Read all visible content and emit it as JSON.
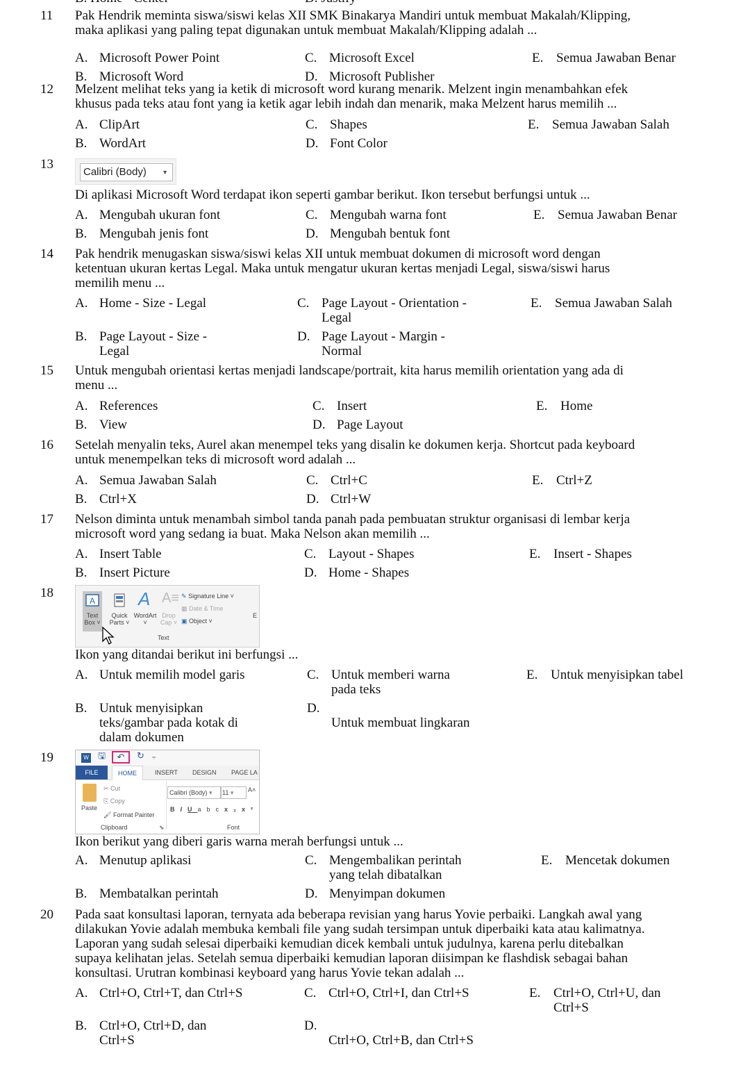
{
  "document": {
    "cut_line": {
      "left": "B.  Home - Center",
      "right": "D.  Justify"
    },
    "questions": [
      {
        "num": "11",
        "text": [
          "Pak Hendrik meminta siswa/siswi kelas XII SMK Binakarya Mandiri untuk membuat Makalah/Klipping,",
          "maka aplikasi yang paling tepat digunakan untuk membuat Makalah/Klipping adalah ..."
        ],
        "options": {
          "A": [
            "Microsoft Power Point"
          ],
          "B": [
            "Microsoft Word"
          ],
          "C": [
            "Microsoft Excel"
          ],
          "D": [
            "Microsoft Publisher"
          ],
          "E": [
            "Semua Jawaban Benar"
          ]
        }
      },
      {
        "num": "12",
        "text": [
          "Melzent melihat teks yang ia ketik di microsoft word kurang menarik. Melzent ingin menambahkan efek",
          "khusus pada teks atau font yang ia ketik agar lebih indah dan menarik, maka Melzent harus memilih ..."
        ],
        "options": {
          "A": [
            "ClipArt"
          ],
          "B": [
            "WordArt"
          ],
          "C": [
            "Shapes"
          ],
          "D": [
            "Font Color"
          ],
          "E": [
            "Semua Jawaban Salah"
          ]
        }
      },
      {
        "num": "13",
        "image": {
          "font_box_value": "Calibri (Body)",
          "dropdown_icon": "caret-down"
        },
        "text": [
          "Di aplikasi Microsoft Word terdapat ikon seperti gambar berikut. Ikon tersebut berfungsi untuk ..."
        ],
        "options": {
          "A": [
            "Mengubah ukuran font"
          ],
          "B": [
            "Mengubah jenis font"
          ],
          "C": [
            "Mengubah warna font"
          ],
          "D": [
            "Mengubah bentuk font"
          ],
          "E": [
            "Semua Jawaban Benar"
          ]
        }
      },
      {
        "num": "14",
        "text": [
          "Pak hendrik menugaskan siswa/siswi kelas XII untuk membuat dokumen di microsoft word dengan",
          "ketentuan ukuran kertas Legal. Maka untuk mengatur ukuran kertas menjadi Legal, siswa/siswi harus",
          "memilih menu ..."
        ],
        "options": {
          "A": [
            "Home - Size - Legal"
          ],
          "B": [
            "Page Layout - Size -",
            "Legal"
          ],
          "C": [
            "Page Layout - Orientation -",
            "Legal"
          ],
          "D": [
            "Page Layout - Margin -",
            "Normal"
          ],
          "E": [
            "Semua Jawaban Salah"
          ]
        }
      },
      {
        "num": "15",
        "text": [
          "Untuk mengubah orientasi kertas menjadi landscape/portrait, kita harus memilih orientation yang ada di",
          "menu ..."
        ],
        "options": {
          "A": [
            "References"
          ],
          "B": [
            "View"
          ],
          "C": [
            "Insert"
          ],
          "D": [
            "Page Layout"
          ],
          "E": [
            "Home"
          ]
        }
      },
      {
        "num": "16",
        "text": [
          "Setelah menyalin teks, Aurel akan menempel teks yang disalin ke dokumen kerja. Shortcut pada keyboard",
          "untuk menempelkan teks di microsoft word adalah ..."
        ],
        "options": {
          "A": [
            "Semua Jawaban Salah"
          ],
          "B": [
            "Ctrl+X"
          ],
          "C": [
            "Ctrl+C"
          ],
          "D": [
            "Ctrl+W"
          ],
          "E": [
            "Ctrl+Z"
          ]
        }
      },
      {
        "num": "17",
        "text": [
          "Nelson diminta untuk menambah simbol tanda panah pada pembuatan struktur organisasi di lembar kerja",
          "microsoft word yang sedang ia buat. Maka Nelson akan memilih ..."
        ],
        "options": {
          "A": [
            "Insert Table"
          ],
          "B": [
            "Insert Picture"
          ],
          "C": [
            "Layout - Shapes"
          ],
          "D": [
            "Home - Shapes"
          ],
          "E": [
            "Insert - Shapes"
          ]
        }
      },
      {
        "num": "18",
        "image": {
          "items": {
            "text_box": [
              "Text",
              "Box ˅"
            ],
            "quick_parts": [
              "Quick",
              "Parts ˅"
            ],
            "wordart": [
              "WordArt",
              "˅"
            ],
            "drop_cap": [
              "Drop",
              "Cap ˅"
            ],
            "signature_line": "Signature Line  ˅",
            "date_time": "Date & Time",
            "object": "Object  ˅",
            "group_label": "Text",
            "cut_label": "E"
          }
        },
        "text": [
          "Ikon yang ditandai berikut ini berfungsi ..."
        ],
        "options": {
          "A": [
            "Untuk memilih model garis"
          ],
          "B": [
            "Untuk menyisipkan",
            "teks/gambar pada kotak di",
            "dalam dokumen"
          ],
          "C": [
            "Untuk memberi warna",
            "pada teks"
          ],
          "D": [
            "",
            "Untuk membuat lingkaran"
          ],
          "E": [
            "Untuk menyisipkan tabel"
          ]
        }
      },
      {
        "num": "19",
        "image": {
          "tabs": [
            "FILE",
            "HOME",
            "INSERT",
            "DESIGN",
            "PAGE LA"
          ],
          "clipboard": {
            "paste": "Paste",
            "cut": "Cut",
            "copy": "Copy",
            "format_painter": "Format Painter",
            "label": "Clipboard"
          },
          "font": {
            "name": "Calibri (Body)",
            "size": "11",
            "label": "Font",
            "buttons": [
              "B",
              "I",
              "U",
              "abc",
              "x₂",
              "x²"
            ]
          },
          "highlight_color": "#d6247a"
        },
        "text": [
          "Ikon berikut yang diberi garis warna merah berfungsi untuk ..."
        ],
        "options": {
          "A": [
            "Menutup aplikasi"
          ],
          "B": [
            "Membatalkan perintah"
          ],
          "C": [
            "Mengembalikan perintah",
            "yang telah dibatalkan"
          ],
          "D": [
            "Menyimpan dokumen"
          ],
          "E": [
            "Mencetak dokumen"
          ]
        }
      },
      {
        "num": "20",
        "text": [
          "Pada saat konsultasi laporan, ternyata ada beberapa revisian yang harus Yovie perbaiki. Langkah awal yang",
          "dilakukan Yovie adalah membuka kembali file yang sudah tersimpan untuk diperbaiki kata atau kalimatnya.",
          "Laporan yang sudah selesai diperbaiki kemudian dicek kembali untuk judulnya, karena perlu ditebalkan",
          "supaya kelihatan jelas. Setelah semua diperbaiki kemudian laporan diisimpan ke flashdisk sebagai bahan",
          "konsultasi. Urutran kombinasi keyboard yang harus Yovie tekan adalah ..."
        ],
        "options": {
          "A": [
            "Ctrl+O, Ctrl+T, dan Ctrl+S"
          ],
          "B": [
            "Ctrl+O, Ctrl+D, dan",
            "Ctrl+S"
          ],
          "C": [
            "Ctrl+O, Ctrl+I, dan Ctrl+S"
          ],
          "D": [
            "",
            "Ctrl+O, Ctrl+B, dan Ctrl+S"
          ],
          "E": [
            "Ctrl+O, Ctrl+U, dan",
            "Ctrl+S"
          ]
        }
      }
    ]
  }
}
